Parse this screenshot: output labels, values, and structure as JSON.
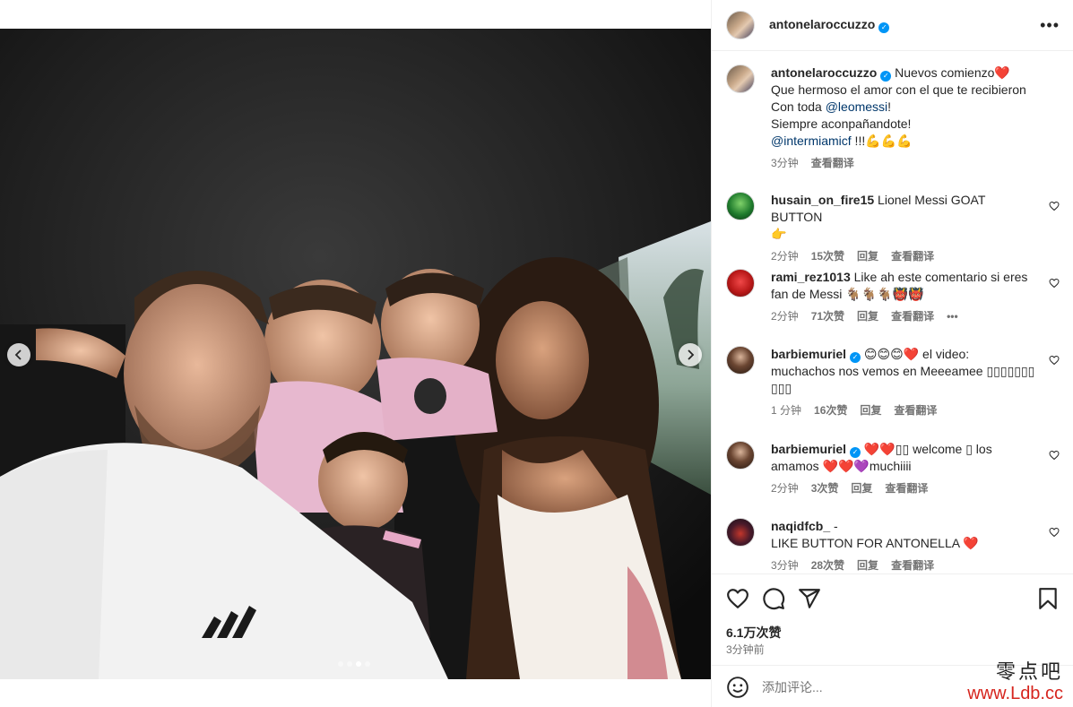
{
  "post": {
    "author": "antonelaroccuzzo",
    "verified": true,
    "more_label": "•••",
    "carousel": {
      "slide_count": 4,
      "active_index": 2
    }
  },
  "caption": {
    "user": "antonelaroccuzzo",
    "line1": "Nuevos comienzo",
    "emoji1": "❤️",
    "line2": "Que hermoso el amor con el que te recibieron",
    "line3_prefix": "Con toda ",
    "line3_mention": "@leomessi",
    "line3_suffix": "!",
    "line4": "Siempre aconpañandote!",
    "line5_mention": "@intermiamicf",
    "line5_suffix": " !!!💪💪💪",
    "time": "3分钟",
    "translate": "查看翻译"
  },
  "comments": [
    {
      "user": "husain_on_fire15",
      "text": "Lionel Messi GOAT BUTTON",
      "text2": "👉",
      "time": "2分钟",
      "likes": "15次赞",
      "reply": "回复",
      "translate": "查看翻译"
    },
    {
      "user": "rami_rez1013",
      "text": "Like ah este comentario si eres",
      "text2": "fan de Messi 🐐🐐🐐👹👹",
      "time": "2分钟",
      "likes": "71次赞",
      "reply": "回复",
      "translate": "查看翻译",
      "more": "•••"
    },
    {
      "user": "barbiemuriel",
      "text": "😊😊😊❤️ el video:",
      "text2": "muchachos nos vemos en Meeeamee ▯▯▯▯▯▯▯",
      "text3": "▯▯▯",
      "time": "1 分钟",
      "likes": "16次赞",
      "reply": "回复",
      "translate": "查看翻译"
    },
    {
      "user": "barbiemuriel",
      "text": "❤️❤️▯▯ welcome ▯ los",
      "text2": "amamos ❤️❤️💜muchiiii",
      "time": "2分钟",
      "likes": "3次赞",
      "reply": "回复",
      "translate": "查看翻译"
    },
    {
      "user": "naqidfcb_",
      "text": "-",
      "text2": "LIKE BUTTON FOR ANTONELLA ❤️",
      "time": "3分钟",
      "likes": "28次赞",
      "reply": "回复",
      "translate": "查看翻译"
    }
  ],
  "footer": {
    "likes": "6.1万次赞",
    "time": "3分钟前",
    "comment_placeholder": "添加评论..."
  },
  "watermark": {
    "top": "零点吧",
    "bottom": "www.Ldb.cc"
  },
  "icons": {
    "like": "heart-icon",
    "comment": "comment-icon",
    "share": "share-icon",
    "save": "bookmark-icon",
    "emoji": "emoji-icon",
    "prev": "chevron-left-icon",
    "next": "chevron-right-icon"
  },
  "colors": {
    "mention": "#00376b",
    "verified": "#0095f6",
    "secondary_text": "#737373",
    "divider": "#efefef",
    "watermark_red": "#d6251e"
  }
}
